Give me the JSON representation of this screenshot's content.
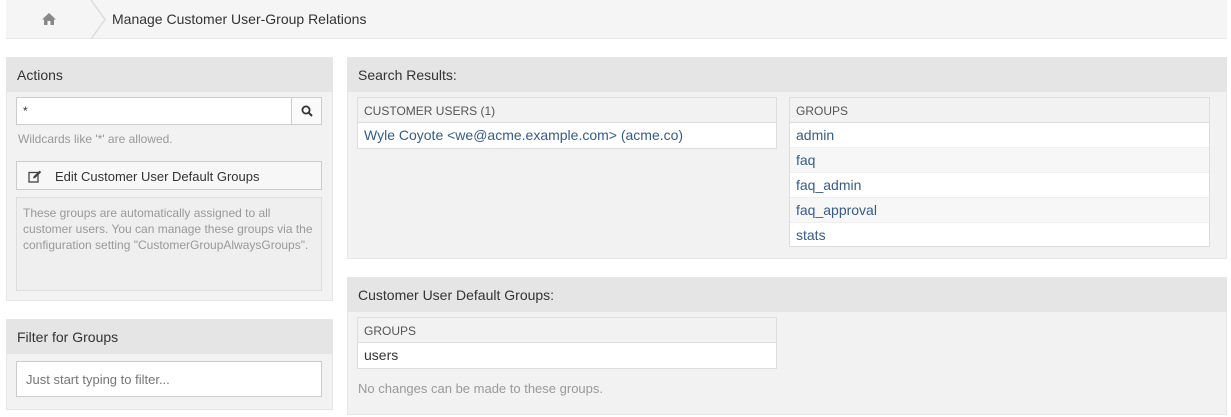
{
  "breadcrumb": {
    "home_icon": "home-icon",
    "title": "Manage Customer User-Group Relations"
  },
  "actions": {
    "header": "Actions",
    "search_value": "*",
    "search_icon": "search-icon",
    "hint": "Wildcards like '*' are allowed.",
    "edit_button_label": "Edit Customer User Default Groups",
    "edit_icon": "edit-icon",
    "note": "These groups are automatically assigned to all customer users. You can manage these groups via the configuration setting \"CustomerGroupAlwaysGroups\"."
  },
  "filter": {
    "header": "Filter for Groups",
    "placeholder": "Just start typing to filter..."
  },
  "search_results": {
    "header": "Search Results:",
    "customer_users_header": "CUSTOMER USERS (1)",
    "customer_users": [
      "Wyle Coyote <we@acme.example.com> (acme.co)"
    ],
    "groups_header": "GROUPS",
    "groups": [
      "admin",
      "faq",
      "faq_admin",
      "faq_approval",
      "stats"
    ]
  },
  "default_groups": {
    "header": "Customer User Default Groups:",
    "groups_header": "GROUPS",
    "groups": [
      "users"
    ],
    "note": "No changes can be made to these groups."
  }
}
